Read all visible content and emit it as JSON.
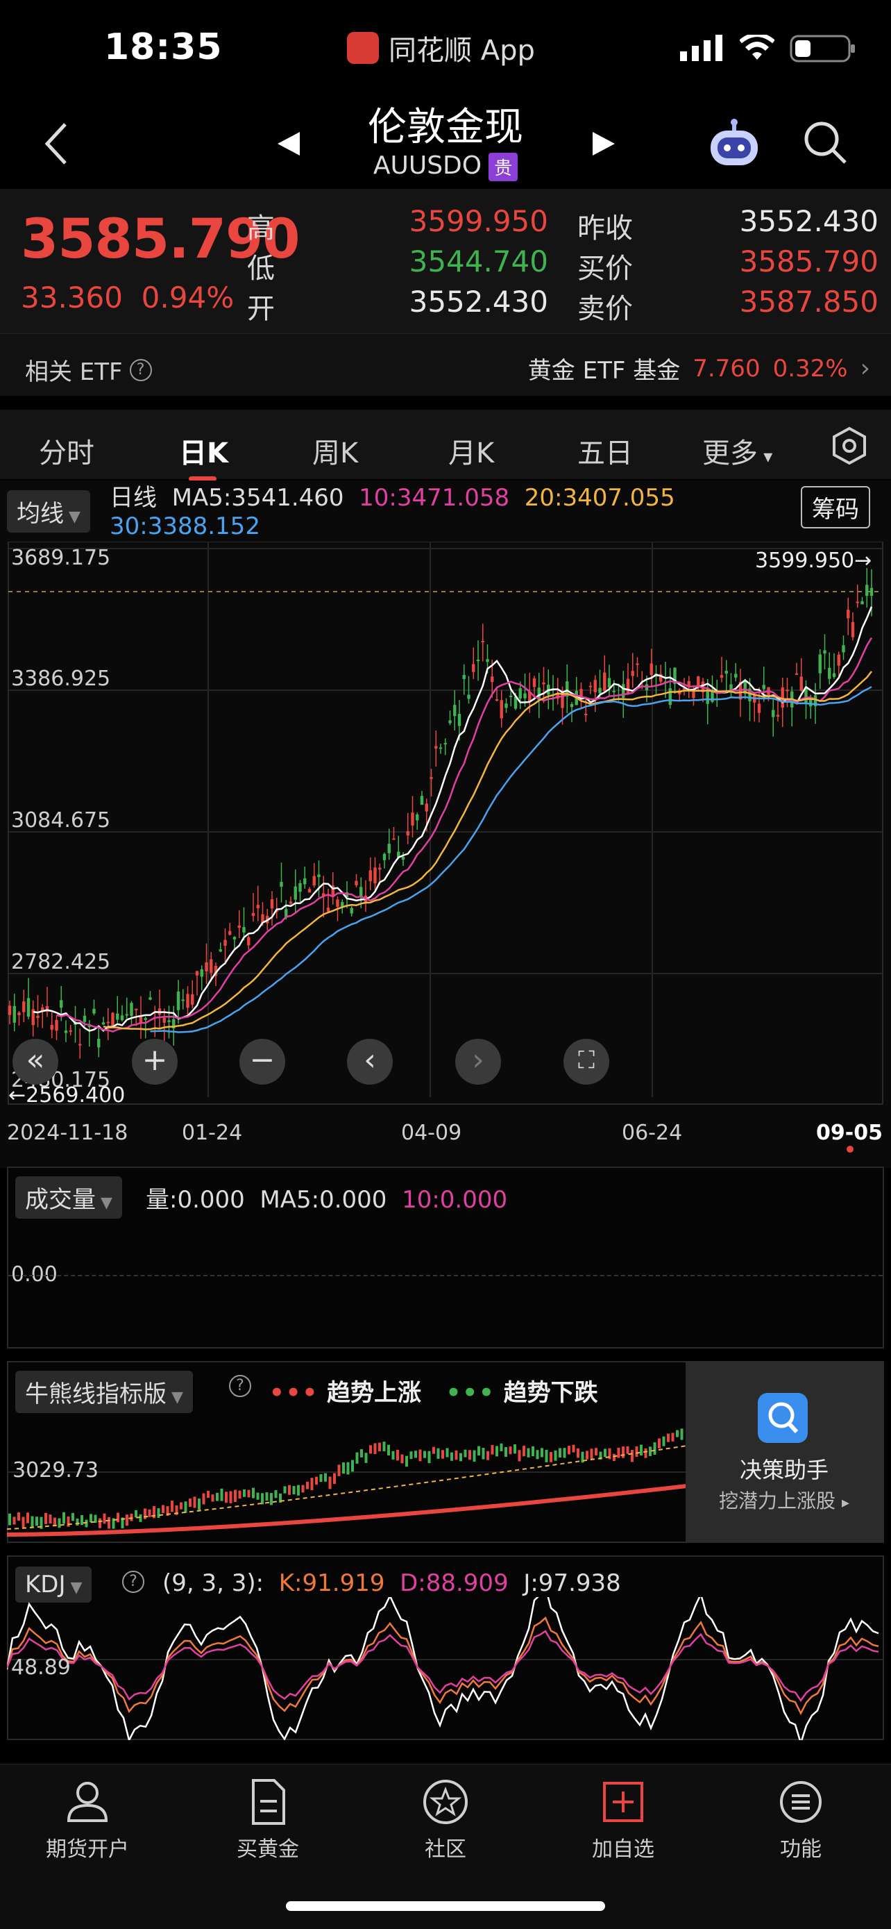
{
  "status_bar": {
    "time": "18:35",
    "app_name": "同花顺 App"
  },
  "header": {
    "title": "伦敦金现",
    "code": "AUUSDO",
    "badge": "贵"
  },
  "quote": {
    "price": "3585.790",
    "change": "33.360",
    "change_pct": "0.94%",
    "high_label": "高",
    "high": "3599.950",
    "low_label": "低",
    "low": "3544.740",
    "open_label": "开",
    "open": "3552.430",
    "prev_close_label": "昨收",
    "prev_close": "3552.430",
    "bid_label": "买价",
    "bid": "3585.790",
    "ask_label": "卖价",
    "ask": "3587.850"
  },
  "etf": {
    "label": "相关 ETF",
    "name": "黄金 ETF 基金",
    "price": "7.760",
    "pct": "0.32%"
  },
  "tabs": [
    "分时",
    "日K",
    "周K",
    "月K",
    "五日",
    "更多"
  ],
  "main_chart": {
    "indicator": "均线",
    "period": "日线",
    "ma5": "MA5:3541.460",
    "ma10": "10:3471.058",
    "ma20": "20:3407.055",
    "ma30": "30:3388.152",
    "chips_button": "筹码",
    "y_ticks": [
      "3689.175",
      "3386.925",
      "3084.675",
      "2782.425",
      "2480.175"
    ],
    "max_marker": "3599.950→",
    "min_marker": "←2569.400",
    "x_ticks": [
      "2024-11-18",
      "01-24",
      "04-09",
      "06-24",
      "09-05"
    ],
    "colors": {
      "up": "#e8463e",
      "down": "#3fb34f",
      "ma5": "#ffffff",
      "ma10": "#e040a0",
      "ma20": "#f2b640",
      "ma30": "#4aa3f0"
    }
  },
  "volume_panel": {
    "indicator": "成交量",
    "vol": "量:0.000",
    "ma5": "MA5:0.000",
    "ma10": "10:0.000",
    "y_tick": "0.00"
  },
  "bull_panel": {
    "indicator": "牛熊线指标版",
    "up_legend": "趋势上涨",
    "down_legend": "趋势下跌",
    "y_tick": "3029.73",
    "assistant_title": "决策助手",
    "assistant_sub": "挖潜力上涨股"
  },
  "kdj_panel": {
    "indicator": "KDJ",
    "params": "(9, 3, 3):",
    "k": "K:91.919",
    "d": "D:88.909",
    "j": "J:97.938",
    "y_tick": "48.89"
  },
  "nav": [
    {
      "label": "期货开户",
      "icon": "person-icon"
    },
    {
      "label": "买黄金",
      "icon": "document-icon"
    },
    {
      "label": "社区",
      "icon": "star-icon"
    },
    {
      "label": "加自选",
      "icon": "plus-box-icon"
    },
    {
      "label": "功能",
      "icon": "menu-icon"
    }
  ]
}
